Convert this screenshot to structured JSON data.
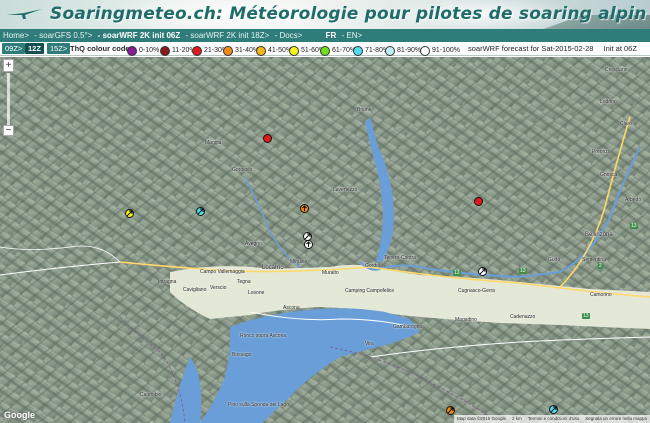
{
  "header": {
    "title": "Soaringmeteo.ch: Météorologie pour pilotes de soaring alpin"
  },
  "nav": {
    "items": [
      {
        "label": "Home>",
        "active": false
      },
      {
        "label": "- soarGFS 0.5°>",
        "active": false
      },
      {
        "label": "- soarWRF 2K init 06Z",
        "active": true
      },
      {
        "label": "- soarWRF 2K init 18Z>",
        "active": false
      },
      {
        "label": "- Docs>",
        "active": false
      }
    ],
    "lang_fr": "FR",
    "lang_en": "- EN>"
  },
  "legend": {
    "times": [
      "09Z>",
      "12Z",
      "15Z>"
    ],
    "selected_time": "12Z",
    "title": "ThQ colour code:",
    "swatches": [
      {
        "label": "0-10%",
        "color": "#8b1a9a"
      },
      {
        "label": "11-20%",
        "color": "#8b1a1a"
      },
      {
        "label": "21-30%",
        "color": "#e01b1b"
      },
      {
        "label": "31-40%",
        "color": "#f08a1a"
      },
      {
        "label": "41-50%",
        "color": "#f5b718"
      },
      {
        "label": "51-60%",
        "color": "#f5f518"
      },
      {
        "label": "61-70%",
        "color": "#6be01b"
      },
      {
        "label": "71-80%",
        "color": "#4ee0f0"
      },
      {
        "label": "81-90%",
        "color": "#bfeef5"
      },
      {
        "label": "91-100%",
        "color": "#ffffff"
      }
    ],
    "forecast": "soarWRF forecast for Sat-2015-02-28",
    "init": "Init at 06Z"
  },
  "map": {
    "zoom_in": "+",
    "zoom_out": "−",
    "places": [
      {
        "name": "Locarno"
      },
      {
        "name": "Ascona"
      },
      {
        "name": "Minusio"
      },
      {
        "name": "Muralto"
      },
      {
        "name": "Tenero-Contra"
      },
      {
        "name": "Campo Vallemaggia"
      },
      {
        "name": "Camping Campofelice"
      },
      {
        "name": "Gambarogno"
      },
      {
        "name": "Cadenazzo"
      },
      {
        "name": "Bellinzona"
      },
      {
        "name": "Gudo"
      },
      {
        "name": "Cugnasco-Gerra"
      },
      {
        "name": "Magadino"
      },
      {
        "name": "Sementina"
      },
      {
        "name": "Camorino"
      },
      {
        "name": "Arbedo"
      },
      {
        "name": "Claro"
      },
      {
        "name": "Lavertezzo"
      },
      {
        "name": "Brione"
      },
      {
        "name": "Gordevio"
      },
      {
        "name": "Maggia"
      },
      {
        "name": "Avegno"
      },
      {
        "name": "Losone"
      },
      {
        "name": "Intragna"
      },
      {
        "name": "Cavigliano"
      },
      {
        "name": "Verscio"
      },
      {
        "name": "Tegna"
      },
      {
        "name": "Brissago"
      },
      {
        "name": "Ronco sopra Ascona"
      },
      {
        "name": "Gordola"
      },
      {
        "name": "Vira"
      },
      {
        "name": "Pino sulla Sponda del Lago"
      },
      {
        "name": "Cannobio"
      },
      {
        "name": "Gnosca"
      },
      {
        "name": "Lodrino"
      },
      {
        "name": "Cresciano"
      },
      {
        "name": "Preonzo"
      }
    ],
    "markers": [
      {
        "color": "#e01b1b",
        "arrow": "none"
      },
      {
        "color": "#e01b1b",
        "arrow": "none"
      },
      {
        "color": "#f5f518",
        "arrow": "ne"
      },
      {
        "color": "#4ee0f0",
        "arrow": "ne"
      },
      {
        "color": "#f08a1a",
        "arrow": "n"
      },
      {
        "color": "#ffffff",
        "arrow": "ne"
      },
      {
        "color": "#ffffff",
        "arrow": "n"
      },
      {
        "color": "#ffffff",
        "arrow": "ne"
      },
      {
        "color": "#f08a1a",
        "arrow": "ne"
      },
      {
        "color": "#4ee0f0",
        "arrow": "ne"
      }
    ],
    "google": "Google",
    "attribution": [
      "Map data ©2015 Google",
      "2 km",
      "Termini e condizioni d'uso",
      "Segnala un errore nella mappa"
    ]
  }
}
